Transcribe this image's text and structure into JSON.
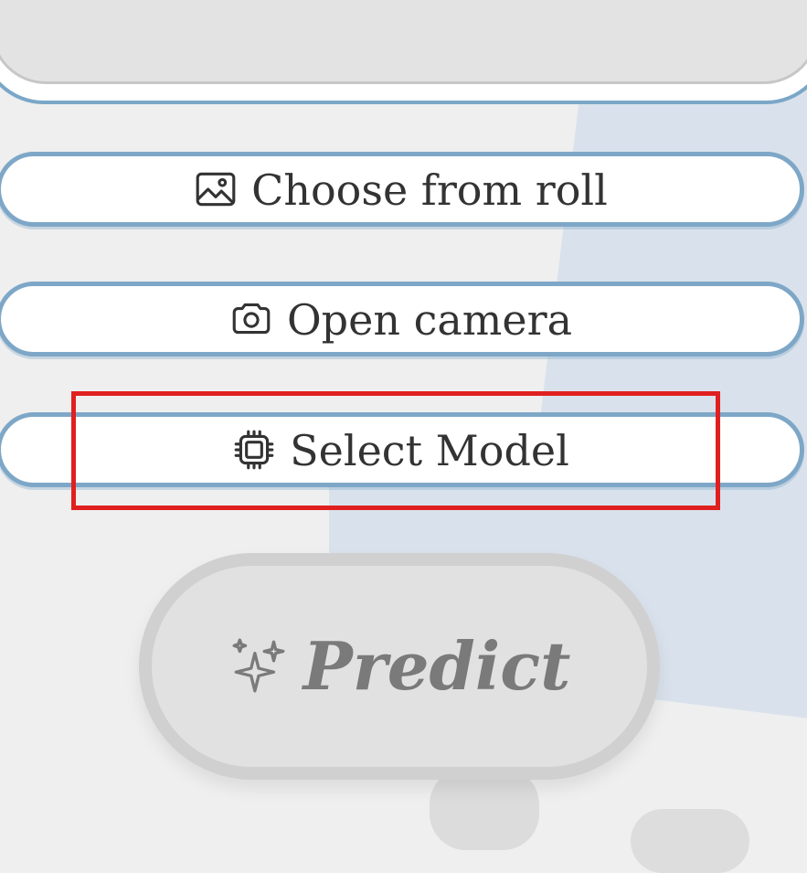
{
  "buttons": {
    "choose_from_roll": "Choose from roll",
    "open_camera": "Open camera",
    "select_model": "Select Model",
    "predict": "Predict"
  },
  "icons": {
    "choose_from_roll": "image-icon",
    "open_camera": "camera-icon",
    "select_model": "chip-icon",
    "predict": "sparkles-icon"
  },
  "colors": {
    "button_border": "#7ea7c7",
    "highlight": "#e02020",
    "predict_disabled": "#7a7a7a",
    "background": "#efefef"
  }
}
